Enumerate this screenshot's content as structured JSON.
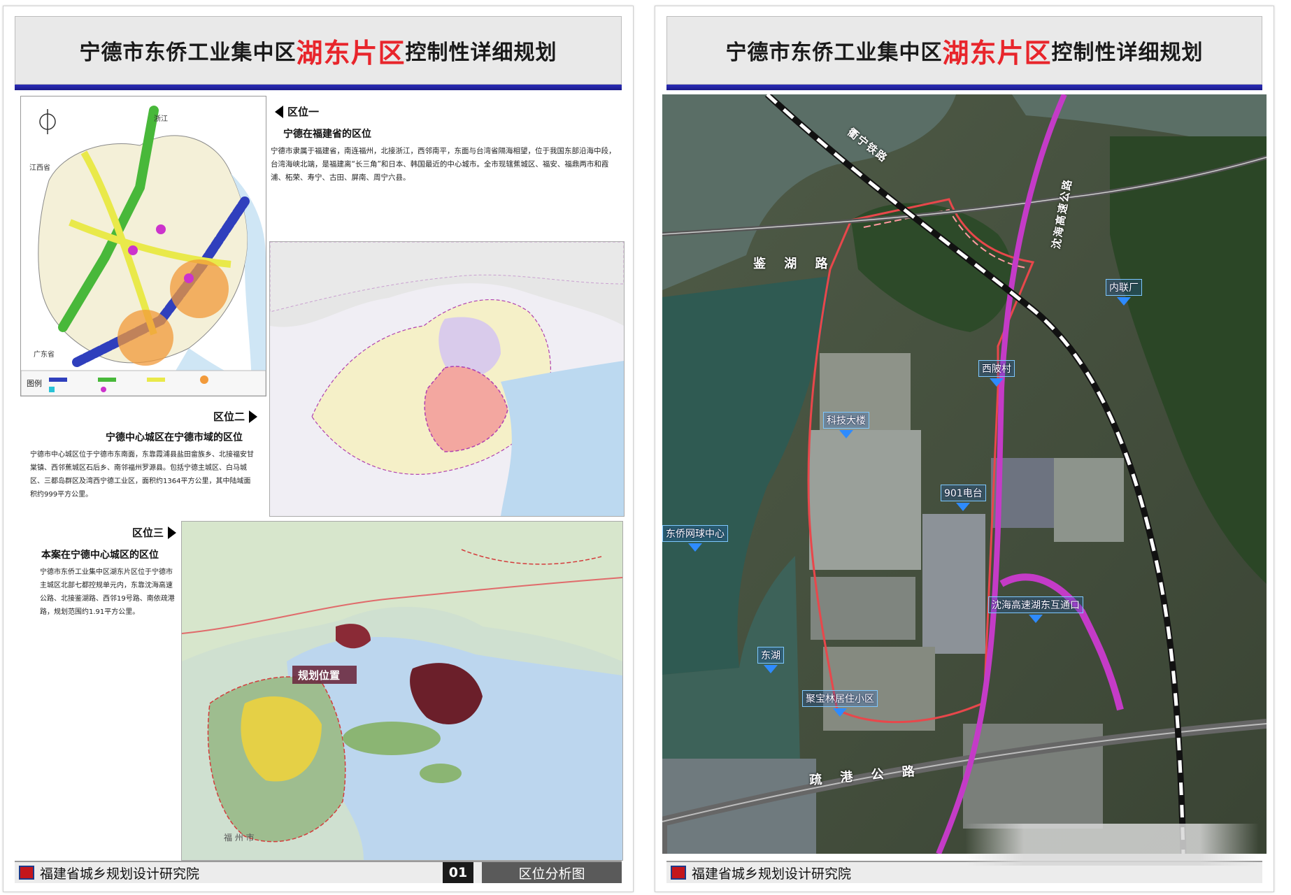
{
  "left_sheet": {
    "title_prefix": "宁德市东侨工业集中区",
    "title_highlight": "湖东片区",
    "title_suffix": "控制性详细规划",
    "footer": {
      "institute": "福建省城乡规划设计研究院",
      "page_number": "01",
      "page_title": "区位分析图"
    },
    "section1": {
      "label": "区位一",
      "heading": "宁德在福建省的区位",
      "text": "宁德市隶属于福建省，南连福州，北接浙江，西邻南平，东面与台湾省隔海相望，位于我国东部沿海中段，台湾海峡北端，是福建离“长三角”和日本、韩国最近的中心城市。全市现辖蕉城区、福安、福鼎两市和霞浦、柘荣、寿宁、古田、屏南、周宁六县。"
    },
    "section2": {
      "label": "区位二",
      "heading": "宁德中心城区在宁德市域的区位",
      "text": "宁德市中心城区位于宁德市东南面，东靠霞浦县盐田畲族乡、北接福安甘棠镇、西邻蕉城区石后乡、南邻福州罗源县。包括宁德主城区、白马城区、三都岛群区及湾西宁德工业区，面积约1364平方公里，其中陆域面积约999平方公里。"
    },
    "section3": {
      "label": "区位三",
      "heading": "本案在宁德中心城区的区位",
      "text": "宁德市东侨工业集中区湖东片区位于宁德市主城区北部七都控规单元内，东靠沈海高速公路、北接鉴湖路、西邻19号路、南依疏港路，规划范围约1.91平方公里。"
    },
    "map1": {
      "legend_title": "图例",
      "province_label_1": "浙江",
      "province_label_2": "江西省",
      "province_label_3": "广东省"
    },
    "map3": {
      "marker": "规划位置",
      "city_label": "福 州 市"
    }
  },
  "right_sheet": {
    "title_prefix": "宁德市东侨工业集中区",
    "title_highlight": "湖东片区",
    "title_suffix": "控制性详细规划",
    "footer": {
      "institute": "福建省城乡规划设计研究院"
    },
    "roads": {
      "r1": "鉴 湖 路",
      "r2": "衢宁铁路",
      "r3": "沈海高速公路",
      "r4": "疏 港 公 路"
    },
    "pois": [
      {
        "name": "内联厂"
      },
      {
        "name": "西陂村"
      },
      {
        "name": "科技大楼"
      },
      {
        "name": "901电台"
      },
      {
        "name": "东侨网球中心"
      },
      {
        "name": "沈海高速湖东互通口"
      },
      {
        "name": "东湖"
      },
      {
        "name": "聚宝林居住小区"
      }
    ]
  },
  "colors": {
    "title_red": "#e8252b",
    "bar_blue": "#23239e",
    "boundary_red": "#e8474b",
    "highway_magenta": "#c43bc7"
  }
}
